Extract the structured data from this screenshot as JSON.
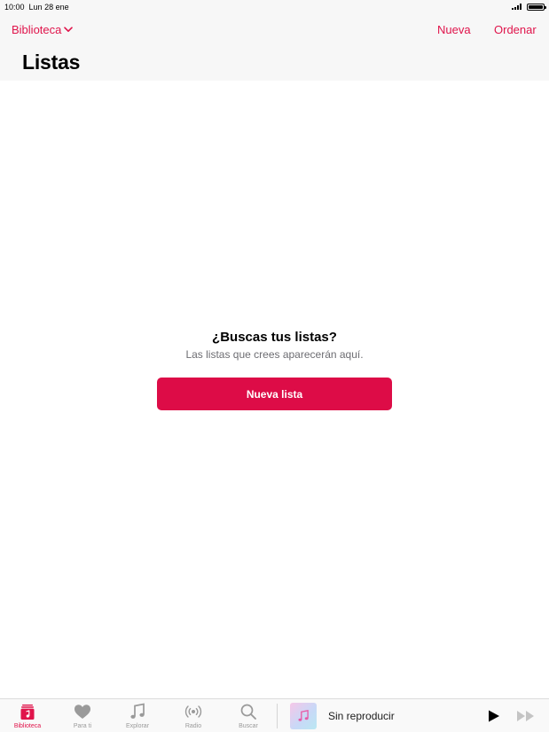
{
  "status_bar": {
    "time": "10:00",
    "date": "Lun 28 ene"
  },
  "header": {
    "library_dropdown": "Biblioteca",
    "new_label": "Nueva",
    "sort_label": "Ordenar",
    "title": "Listas"
  },
  "empty_state": {
    "title": "¿Buscas tus listas?",
    "subtitle": "Las listas que crees aparecerán aquí.",
    "button": "Nueva lista"
  },
  "tabs": [
    {
      "label": "Biblioteca",
      "icon": "library-icon",
      "active": true
    },
    {
      "label": "Para ti",
      "icon": "heart-icon",
      "active": false
    },
    {
      "label": "Explorar",
      "icon": "music-note-icon",
      "active": false
    },
    {
      "label": "Radio",
      "icon": "radio-icon",
      "active": false
    },
    {
      "label": "Buscar",
      "icon": "search-icon",
      "active": false
    }
  ],
  "mini_player": {
    "title": "Sin reproducir",
    "art_icon": "music-note-icon"
  },
  "colors": {
    "accent": "#e0144b",
    "button": "#dd0c47",
    "inactive": "#9a9a9a"
  }
}
